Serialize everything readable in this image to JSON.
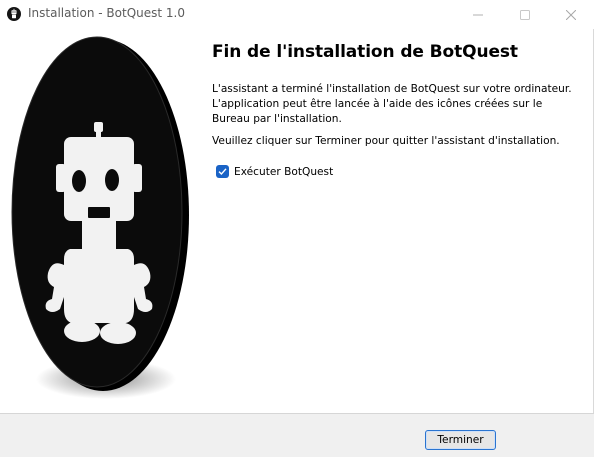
{
  "window": {
    "title": "Installation - BotQuest 1.0",
    "icon": "botquest-app-icon"
  },
  "titlebar_controls": [
    "minimize-icon",
    "maximize-icon",
    "close-icon"
  ],
  "banner": {
    "image": "botquest-robot-logo"
  },
  "content": {
    "heading": "Fin de l'installation de BotQuest",
    "paragraph1": "L'assistant a terminé l'installation de BotQuest sur votre ordinateur. L'application peut être lancée à l'aide des icônes créées sur le Bureau par l'installation.",
    "paragraph2": "Veuillez cliquer sur Terminer pour quitter l'assistant d'installation.",
    "run_checkbox": {
      "label": "Exécuter BotQuest",
      "checked": true
    }
  },
  "footer": {
    "finish_label": "Terminer"
  },
  "colors": {
    "accent": "#1a63c6",
    "footer_bg": "#f0f0f0"
  }
}
